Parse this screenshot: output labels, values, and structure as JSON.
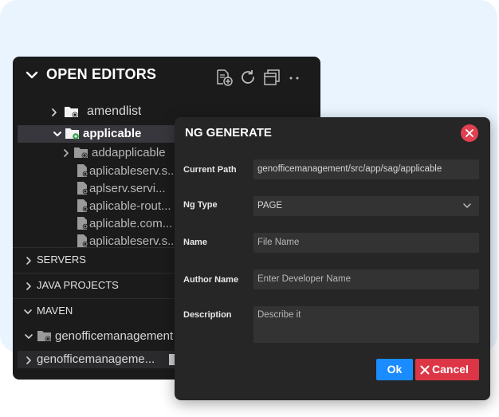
{
  "explorer": {
    "title": "OPEN EDITORS",
    "header_icons": [
      "new-file-icon",
      "refresh-icon",
      "collapse-all-icon",
      "more-icon"
    ],
    "tree": [
      {
        "label": "amendlist",
        "type": "folder",
        "expanded": false
      },
      {
        "label": "applicable",
        "type": "folder",
        "expanded": true,
        "selected": true
      },
      {
        "label": "addapplicable",
        "type": "folder",
        "expanded": false
      },
      {
        "label": "aplicableserv.s...",
        "type": "file"
      },
      {
        "label": "aplserv.servi...",
        "type": "file"
      },
      {
        "label": "aplicable-rout...",
        "type": "file"
      },
      {
        "label": "aplicable.com...",
        "type": "file"
      },
      {
        "label": "aplicableserv.s...",
        "type": "file"
      }
    ],
    "sections": [
      {
        "label": "SERVERS",
        "expanded": false
      },
      {
        "label": "JAVA PROJECTS",
        "expanded": false
      },
      {
        "label": "MAVEN",
        "expanded": true
      }
    ],
    "maven_item": "genofficemanagement",
    "bottom_item": "genofficemanageme..."
  },
  "dialog": {
    "title": "NG GENERATE",
    "fields": {
      "current_path": {
        "label": "Current Path",
        "value": "genofficemanagement/src/app/sag/applicable"
      },
      "ng_type": {
        "label": "Ng Type",
        "value": "PAGE"
      },
      "name": {
        "label": "Name",
        "placeholder": "File Name"
      },
      "author": {
        "label": "Author Name",
        "placeholder": "Enter Developer Name"
      },
      "description": {
        "label": "Description",
        "placeholder": "Describe it"
      }
    },
    "ok_label": "Ok",
    "cancel_label": "Cancel"
  },
  "colors": {
    "panel_bg": "#1b1b1c",
    "dialog_bg": "#262626",
    "field_bg": "#333333",
    "ok": "#1a8cff",
    "cancel": "#dc3545",
    "close": "#e04050",
    "selected_row": "#37373d",
    "page_bg": "#eaf4fe"
  }
}
